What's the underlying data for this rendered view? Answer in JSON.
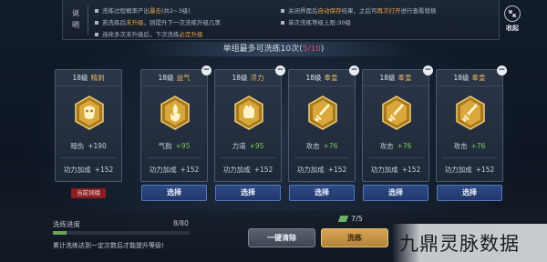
{
  "header": {
    "label": "说明",
    "rules_left": [
      {
        "pre": "洗练过程概率产出",
        "hl": "暴击",
        "post": "(共2~3级)"
      },
      {
        "pre": "若洗练后",
        "hl": "未升级",
        "post": "，则提升下一次洗练升级几率"
      },
      {
        "pre": "连续多次未升级后，下次洗练",
        "hl": "必定升级",
        "post": ""
      }
    ],
    "rules_right": [
      {
        "pre": "关闭界面后",
        "hl": "自动保存",
        "post": "结果，之后可",
        "hl2": "再次打开",
        "post2": "进行查看替换"
      },
      {
        "pre": "单次洗练等级上限:30级",
        "hl": "",
        "post": "",
        "hl2": "",
        "post2": ""
      }
    ],
    "collapse_label": "收起",
    "collapse_icon": "arrows-in-icon"
  },
  "banner": {
    "text": "单组最多可洗练10次(",
    "count": "5/10",
    "close": ")"
  },
  "current": {
    "level": "18级",
    "name": "精剥",
    "stat_name": "暗伤",
    "stat_value": "+190",
    "power_label": "功力加成",
    "power_value": "+152",
    "badge": "当前词缀",
    "icon": "bull-head-icon"
  },
  "options": [
    {
      "level": "18级",
      "name": "益气",
      "stat_name": "气韵",
      "stat_value": "+95",
      "power_label": "功力加成",
      "power_value": "+152",
      "select": "选择",
      "icon": "flame-icon"
    },
    {
      "level": "18级",
      "name": "浮力",
      "stat_name": "力道",
      "stat_value": "+95",
      "power_label": "功力加成",
      "power_value": "+152",
      "select": "选择",
      "icon": "fist-icon"
    },
    {
      "level": "18级",
      "name": "奉皇",
      "stat_name": "攻击",
      "stat_value": "+76",
      "power_label": "功力加成",
      "power_value": "+152",
      "select": "选择",
      "icon": "sword-icon"
    },
    {
      "level": "18级",
      "name": "奉皇",
      "stat_name": "攻击",
      "stat_value": "+76",
      "power_label": "功力加成",
      "power_value": "+152",
      "select": "选择",
      "icon": "sword-icon"
    },
    {
      "level": "18级",
      "name": "奉皇",
      "stat_name": "攻击",
      "stat_value": "+76",
      "power_label": "功力加成",
      "power_value": "+152",
      "select": "选择",
      "icon": "sword-icon"
    }
  ],
  "progress": {
    "label": "洗练进度",
    "value": "8/80",
    "fraction": 0.1,
    "tip": "累计洗练达到一定次数后才能提升等级!"
  },
  "cost": {
    "value": "7/5",
    "icon": "jade-icon"
  },
  "buttons": {
    "clear": "一键清除",
    "wash": "洗练"
  },
  "watermark": "九鼎灵脉数据"
}
